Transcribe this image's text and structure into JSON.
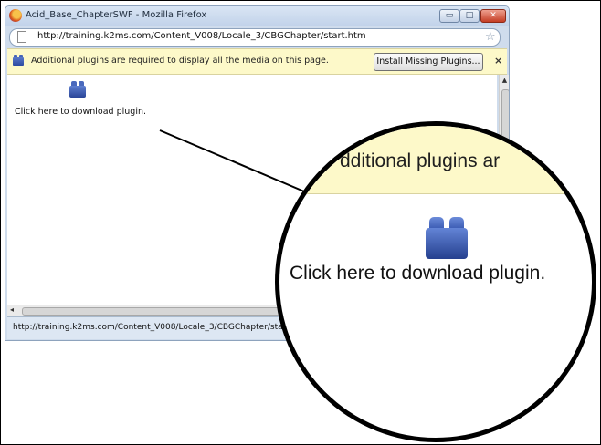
{
  "window": {
    "title": "Acid_Base_ChapterSWF - Mozilla Firefox",
    "controls": {
      "minimize": "▭",
      "maximize": "□",
      "close": "✕"
    }
  },
  "address_bar": {
    "url": "http://training.k2ms.com/Content_V008/Locale_3/CBGChapter/start.htm",
    "bookmark_icon": "star-icon"
  },
  "notification_bar": {
    "message": "Additional plugins are required to display all the media on this page.",
    "install_button_label": "Install Missing Plugins...",
    "close_label": "×"
  },
  "content": {
    "plugin_placeholder_label": "Click here to download plugin.",
    "plugin_icon": "lego-brick-icon"
  },
  "status_bar": {
    "text": "http://training.k2ms.com/Content_V008/Locale_3/CBGChapter/start.htm"
  },
  "magnifier": {
    "notify_excerpt": "dditional plugins ar",
    "download_label": "Click here to download plugin."
  },
  "colors": {
    "notification_bg": "#fdf9c9",
    "window_chrome": "#cfdcec",
    "plugin_blue": "#3c5cb0"
  }
}
